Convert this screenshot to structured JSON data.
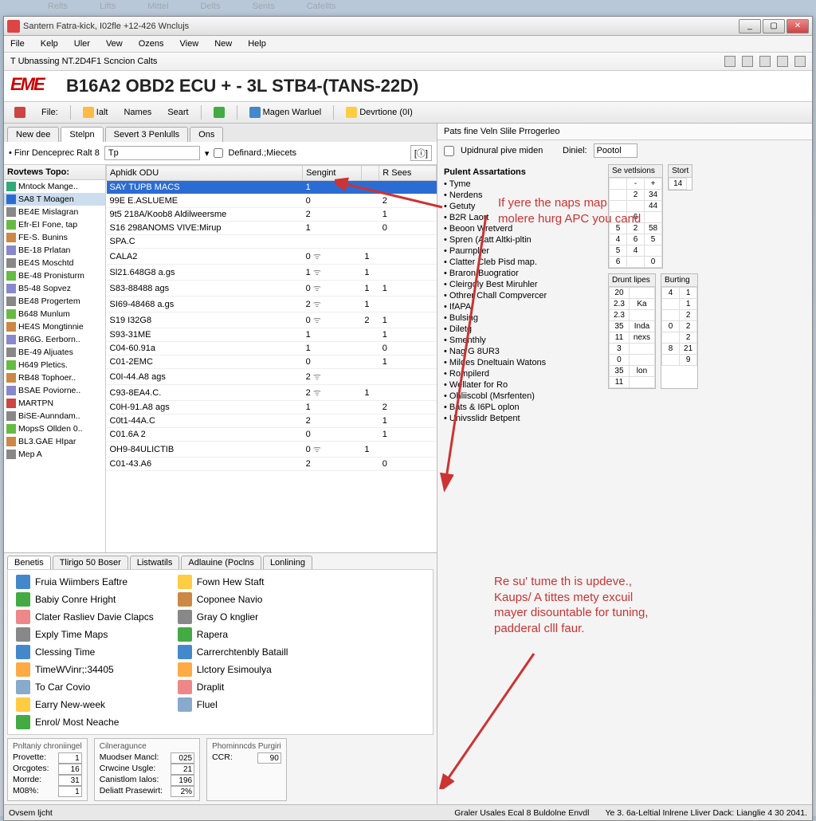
{
  "faint_tabs": [
    "Relts",
    "Lifts",
    "Mittel",
    "Delts",
    "Sents",
    "Cafellts"
  ],
  "window_title": "Santern Fatra-kick, I02fle +12-426 Wnclujs",
  "menu": [
    "File",
    "Kelp",
    "Uler",
    "Vew",
    "Ozens",
    "View",
    "New",
    "Help"
  ],
  "subheader": "T Ubnassing NT.2D4F1 Scncion Calts",
  "logo": "EME",
  "big_title": "B16A2 OBD2 ECU + - 3L STB4-(TANS-22D)",
  "toolbar": {
    "file": "File:",
    "ialt": "Ialt",
    "names": "Names",
    "seart": "Seart",
    "magen": "Magen Warluel",
    "devt": "Devrtione (0I)"
  },
  "left_tabs": [
    "New dee",
    "Stelpn",
    "Severt 3 Penlulls",
    "Ons"
  ],
  "left_subbar": {
    "label": "• Finr Denceprec Ralt 8",
    "field": "Tp",
    "def": "Definard.;Miecets"
  },
  "tree_header": "Rovtews Topo:",
  "tree_items": [
    {
      "c": "#3a7",
      "t": "Mntock Mange.."
    },
    {
      "c": "#2b6cd4",
      "t": "SA8 T Moagen",
      "sel": true
    },
    {
      "c": "#888",
      "t": "BE4E Mislagran"
    },
    {
      "c": "#6b4",
      "t": "Efr-EI Fone, tap"
    },
    {
      "c": "#c84",
      "t": "FE-S. Bunins"
    },
    {
      "c": "#88c",
      "t": "BE-18 Prlatan"
    },
    {
      "c": "#888",
      "t": "BE4S Moschtd"
    },
    {
      "c": "#6b4",
      "t": "BE-48 Pronisturm"
    },
    {
      "c": "#88c",
      "t": "B5-48 Sopvez"
    },
    {
      "c": "#888",
      "t": "BE48 Progertem"
    },
    {
      "c": "#6b4",
      "t": "B648 Munlum"
    },
    {
      "c": "#c84",
      "t": "HE4S Mongtinnie"
    },
    {
      "c": "#88c",
      "t": "BR6G. Eerborn.."
    },
    {
      "c": "#888",
      "t": "BE-49 Aljuates"
    },
    {
      "c": "#6b4",
      "t": "H649 Pletics."
    },
    {
      "c": "#c84",
      "t": "RB48 Tophoer.."
    },
    {
      "c": "#88c",
      "t": "BSAE Poviorne.."
    },
    {
      "c": "#c44",
      "t": "MARTPN"
    },
    {
      "c": "#888",
      "t": "BiSE-Aunndam.."
    },
    {
      "c": "#6b4",
      "t": "MopsS Ollden 0.."
    },
    {
      "c": "#c84",
      "t": "BL3.GAE HIpar"
    },
    {
      "c": "#888",
      "t": "Mep A"
    }
  ],
  "grid_headers": [
    "Aphidk ODU",
    "Sengint",
    "",
    "R Sees"
  ],
  "grid_rows": [
    {
      "a": "SAY TUPB MACS",
      "b": "1",
      "c": "",
      "d": "",
      "sel": true
    },
    {
      "a": "99E E.ASLUEME",
      "b": "0",
      "c": "",
      "d": "2"
    },
    {
      "a": "9t5 218A/Koob8 Aldilweersme",
      "b": "2",
      "c": "",
      "d": "1"
    },
    {
      "a": "S16 298ANOMS VIVE:Mirup",
      "b": "1",
      "c": "",
      "d": "0"
    },
    {
      "a": "SPA.C",
      "b": "",
      "c": "",
      "d": ""
    },
    {
      "a": "CALA2",
      "b": "0",
      "c": "1",
      "d": "",
      "w": true
    },
    {
      "a": "Sl21.648G8 a.gs",
      "b": "1",
      "c": "1",
      "d": "",
      "w": true
    },
    {
      "a": "S83-88488 ags",
      "b": "0",
      "c": "1",
      "d": "1",
      "w": true
    },
    {
      "a": "SI69-48468 a.gs",
      "b": "2",
      "c": "1",
      "d": "",
      "w": true
    },
    {
      "a": "S19 I32G8",
      "b": "0",
      "c": "2",
      "d": "1",
      "w": true
    },
    {
      "a": "S93-31ME",
      "b": "1",
      "c": "",
      "d": "1"
    },
    {
      "a": "C04-60.91a",
      "b": "1",
      "c": "",
      "d": "0"
    },
    {
      "a": "C01-2EMC",
      "b": "0",
      "c": "",
      "d": "1"
    },
    {
      "a": "C0I-44.A8 ags",
      "b": "2",
      "c": "",
      "d": "",
      "w": true
    },
    {
      "a": "C93-8EA4.C.",
      "b": "2",
      "c": "1",
      "d": "",
      "w": true
    },
    {
      "a": "C0H-91.A8 ags",
      "b": "1",
      "c": "",
      "d": "2"
    },
    {
      "a": "C0t1-44A.C",
      "b": "2",
      "c": "",
      "d": "1"
    },
    {
      "a": "C01.6A 2",
      "b": "0",
      "c": "",
      "d": "1"
    },
    {
      "a": "OH9-84ULICTIB",
      "b": "0",
      "c": "1",
      "d": "",
      "w": true
    },
    {
      "a": "C01-43.A6",
      "b": "2",
      "c": "",
      "d": "0"
    }
  ],
  "bottom_tabs": [
    "Benetis",
    "Tlirigo 50 Boser",
    "Listwatils",
    "Adlauine (Poclns",
    "Lonlining"
  ],
  "links_left": [
    {
      "c": "#48c",
      "t": "Fruia Wiimbers Eaftre"
    },
    {
      "c": "#4a4",
      "t": "Babiy Conre Hright"
    },
    {
      "c": "#e88",
      "t": "Clater Rasliev Davie Clapcs"
    },
    {
      "c": "#888",
      "t": "Exply Time Maps"
    },
    {
      "c": "#48c",
      "t": "Clessing Time"
    },
    {
      "c": "#fa4",
      "t": "TimeWVinr;:34405"
    },
    {
      "c": "#8ac",
      "t": "To Car Covio"
    },
    {
      "c": "#fc4",
      "t": "Earry New-week"
    },
    {
      "c": "#4a4",
      "t": "Enrol/ Most Neache"
    }
  ],
  "links_right": [
    {
      "c": "#fc4",
      "t": "Fown Hew Staft"
    },
    {
      "c": "#c84",
      "t": "Coponee Navio"
    },
    {
      "c": "#888",
      "t": "Gray O knglier"
    },
    {
      "c": "#4a4",
      "t": "Rapera"
    },
    {
      "c": "#48c",
      "t": "Carrerchtenbly Bataill"
    },
    {
      "c": "#fa4",
      "t": "Llctory Esimoulya"
    },
    {
      "c": "#e88",
      "t": "Draplit"
    },
    {
      "c": "#8ac",
      "t": "Fluel"
    }
  ],
  "stats": [
    {
      "h": "Pnltaniy chroniingel",
      "rows": [
        [
          "Provette:",
          "1"
        ],
        [
          "Orcgotes:",
          "16"
        ],
        [
          "Morrde:",
          "31"
        ],
        [
          "M08%:",
          "1"
        ]
      ]
    },
    {
      "h": "Cilneragunce",
      "rows": [
        [
          "Muodser Mancl:",
          "025"
        ],
        [
          "Crwcine Usgle:",
          "21"
        ],
        [
          "Canistlom Ialos:",
          "196"
        ],
        [
          "Deliatt Prasewirt:",
          "2%"
        ]
      ]
    },
    {
      "h": "Phominncds Purgiri",
      "rows": [
        [
          "CCR:",
          "90"
        ]
      ]
    }
  ],
  "right_header": "Pats fine Veln Slile Prrogerleo",
  "right_sub": {
    "upd": "Upidnural pive miden",
    "din": "Diniel:",
    "pool": "Pootol"
  },
  "right_list_header": "Pulent Assartations",
  "right_list": [
    "Tyme",
    "Nerdens",
    "Getuty",
    "B2R Laort",
    "Beoon Wretverd",
    "Spren (Aatt Altki-pltin",
    "Paurnpller",
    "Clatter Cleb Pisd map.",
    "Braron Buogratior",
    "Cleirgoly Best Miruhler",
    "Othrer Chall Compvercer",
    "IfAPA",
    "Bulsing",
    "Diletg",
    "Smenthly",
    "Nag G 8UR3",
    "Mildes Dneltuain Watons",
    "Rompilerd",
    "Wellater for Ro",
    "Ohliiscobl (Msrfenten)",
    "Bats & I6PL oplon",
    "Univsslidr Betpent"
  ],
  "mini_headers": {
    "a": "Se vetlsions",
    "b": "Stort",
    "c": "Drunt lipes",
    "d": "Burting"
  },
  "mini_a": [
    [
      "",
      "-",
      "+"
    ],
    [
      "",
      "2",
      "34"
    ],
    [
      "",
      "",
      "44"
    ],
    [
      "",
      "6",
      ""
    ],
    [
      "5",
      "2",
      "58"
    ],
    [
      "4",
      "6",
      "5"
    ],
    [
      "5",
      "4",
      ""
    ],
    [
      "6",
      "",
      "0"
    ]
  ],
  "mini_c": [
    [
      "20",
      ""
    ],
    [
      "2.3",
      "Ka"
    ],
    [
      "2.3",
      ""
    ],
    [
      "35",
      "Inda"
    ],
    [
      "11",
      "nexs"
    ],
    [
      "3",
      ""
    ],
    [
      "0",
      ""
    ],
    [
      "35",
      "lon"
    ],
    [
      "11",
      ""
    ]
  ],
  "mini_d": [
    [
      "4",
      "1"
    ],
    [
      "",
      "1"
    ],
    [
      "",
      "2"
    ],
    [
      "0",
      "2"
    ],
    [
      "",
      "2"
    ],
    [
      "8",
      "21"
    ],
    [
      "",
      "9"
    ]
  ],
  "anno1": "If yere the naps map\nmolere hurg APC you cand",
  "anno2": "Re su' tume th is updeve.,\nKaups/ A tittes mety excuil\nmayer disountable for tuning,\npadderal clll faur.",
  "status": {
    "a": "Ovsem ljcht",
    "b": "Graler Usales Ecal 8 Buldolne Envdl",
    "c": "Ye 3. 6a-Leltial Inlrene Lliver Dack: Lianglie 4  30 2041."
  }
}
